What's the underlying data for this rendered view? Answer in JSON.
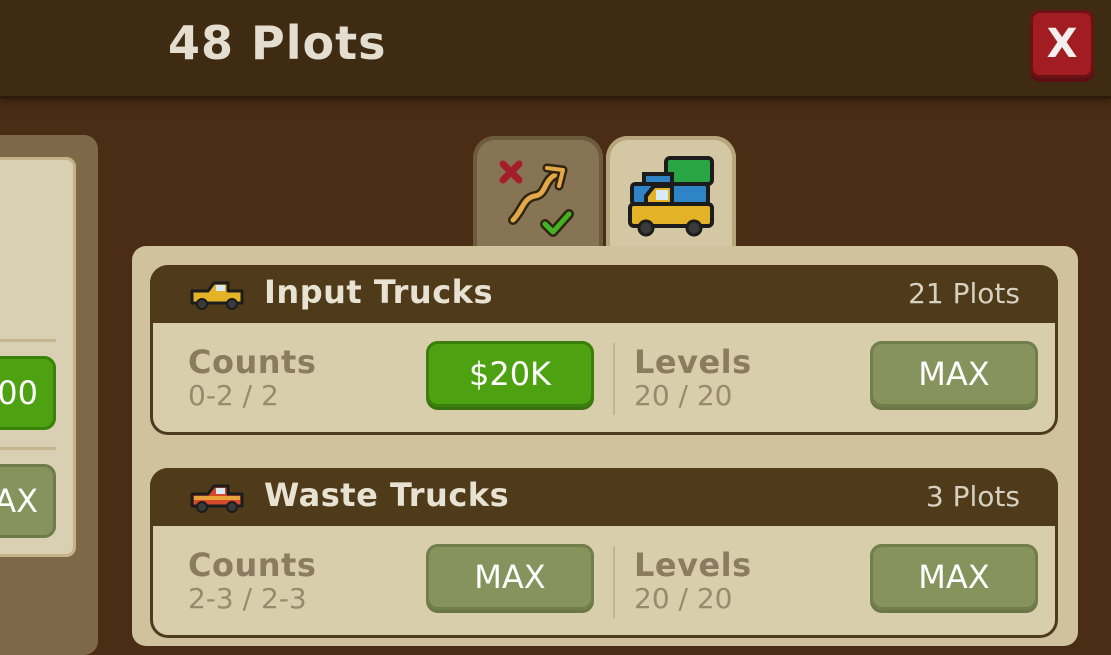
{
  "header": {
    "title": "48 Plots",
    "close_label": "X"
  },
  "left_panel": {
    "button_1_label": "00",
    "button_2_label": "AX"
  },
  "tabs": [
    {
      "name": "progress",
      "icon": "progress-arrow-icon",
      "selected": false
    },
    {
      "name": "trucks",
      "icon": "trucks-stack-icon",
      "selected": true
    }
  ],
  "cards": [
    {
      "title": "Input Trucks",
      "icon": "yellow-truck-icon",
      "plots": "21 Plots",
      "counts_label": "Counts",
      "counts_value": "0-2 / 2",
      "counts_button": "$20K",
      "levels_label": "Levels",
      "levels_value": "20 / 20",
      "levels_button": "MAX"
    },
    {
      "title": "Waste Trucks",
      "icon": "red-truck-icon",
      "plots": "3 Plots",
      "counts_label": "Counts",
      "counts_value": "2-3 / 2-3",
      "counts_button": "MAX",
      "levels_label": "Levels",
      "levels_value": "20 / 20",
      "levels_button": "MAX"
    }
  ],
  "colors": {
    "background": "#4a2d14",
    "header": "#3f2a12",
    "close_red": "#a21d22",
    "buy_green": "#4ea111",
    "max_olive": "#86935d",
    "card_bg": "#d9ceac"
  }
}
